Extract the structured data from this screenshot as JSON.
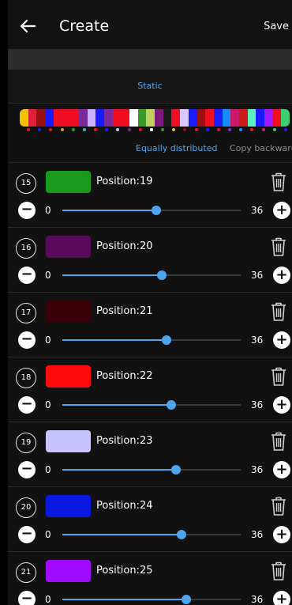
{
  "header": {
    "title": "Create",
    "save_label": "Save"
  },
  "tabs": {
    "static_label": "Static"
  },
  "strip": {
    "colors": [
      "#f2c200",
      "#e0203a",
      "#9a1010",
      "#1a1aff",
      "#ee1020",
      "#ee1020",
      "#ee1020",
      "#7a2a9a",
      "#c8b0ff",
      "#1a1aff",
      "#7a2a9a",
      "#ee1020",
      "#ee1020",
      "#ffffff",
      "#3a9a2a",
      "#c0d060",
      "#7a1a7a",
      "#1a1a1a",
      "#ee1020",
      "#d8c8ff",
      "#1a1aff",
      "#9a1010",
      "#ee1020",
      "#1a1aff",
      "#1a8aff",
      "#cc1a6a",
      "#cc1a1a",
      "#5af0c0",
      "#1a1aff",
      "#a01aff",
      "#ee1020",
      "#3ad070"
    ],
    "dot_colors": [
      "#ee1020",
      "#1a1aff",
      "#ee1020",
      "#d0a020",
      "#2a9a2a",
      "#3ab0e0",
      "#ee1020",
      "#1a1aff",
      "#c0c0ff",
      "#7a2a9a",
      "#ee1020",
      "#ffffff",
      "#3a9a2a",
      "#e0c030",
      "#9a1010",
      "#ee1020",
      "#1a1aff",
      "#ee1020",
      "#a01aff",
      "#1a8aff",
      "#ee1020",
      "#cc1a6a",
      "#3ad070",
      "#1a1aff"
    ]
  },
  "modes": {
    "equal_label": "Equally distributed",
    "copy_label": "Copy backward"
  },
  "items": [
    {
      "index": "15",
      "color": "#1a9a1a",
      "position_label": "Position:19",
      "min": "0",
      "max": "36",
      "value": 19
    },
    {
      "index": "16",
      "color": "#5a0a5a",
      "position_label": "Position:20",
      "min": "0",
      "max": "36",
      "value": 20
    },
    {
      "index": "17",
      "color": "#3a0008",
      "position_label": "Position:21",
      "min": "0",
      "max": "36",
      "value": 21
    },
    {
      "index": "18",
      "color": "#ff0a0a",
      "position_label": "Position:22",
      "min": "0",
      "max": "36",
      "value": 22
    },
    {
      "index": "19",
      "color": "#c8c4ff",
      "position_label": "Position:23",
      "min": "0",
      "max": "36",
      "value": 23
    },
    {
      "index": "20",
      "color": "#0a18e0",
      "position_label": "Position:24",
      "min": "0",
      "max": "36",
      "value": 24
    },
    {
      "index": "21",
      "color": "#a00aff",
      "position_label": "Position:25",
      "min": "0",
      "max": "36",
      "value": 25
    }
  ]
}
